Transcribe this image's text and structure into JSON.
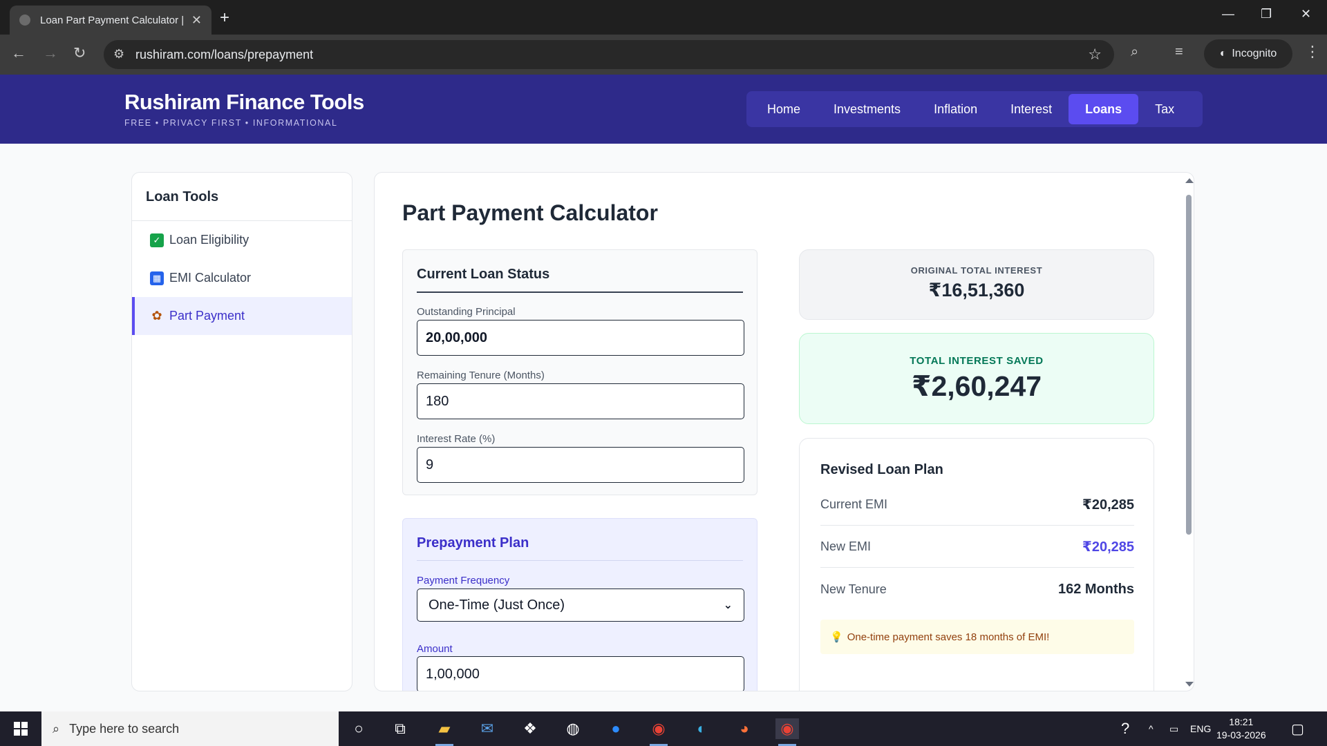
{
  "browser": {
    "tab_title": "Loan Part Payment Calculator | I",
    "url": "rushiram.com/loans/prepayment",
    "incognito_label": "Incognito"
  },
  "site": {
    "brand": "Rushiram Finance Tools",
    "tagline": "FREE • PRIVACY FIRST • INFORMATIONAL",
    "nav": [
      {
        "label": "Home"
      },
      {
        "label": "Investments"
      },
      {
        "label": "Inflation"
      },
      {
        "label": "Interest"
      },
      {
        "label": "Loans",
        "active": true
      },
      {
        "label": "Tax"
      }
    ]
  },
  "sidebar": {
    "title": "Loan Tools",
    "items": [
      {
        "label": "Loan Eligibility",
        "icon": "check-box-icon"
      },
      {
        "label": "EMI Calculator",
        "icon": "calculator-icon"
      },
      {
        "label": "Part Payment",
        "icon": "money-icon",
        "active": true
      }
    ]
  },
  "main": {
    "title": "Part Payment Calculator",
    "current_status": {
      "heading": "Current Loan Status",
      "principal_label": "Outstanding Principal",
      "principal_value": "20,00,000",
      "tenure_label": "Remaining Tenure (Months)",
      "tenure_value": "180",
      "rate_label": "Interest Rate (%)",
      "rate_value": "9"
    },
    "prepayment": {
      "heading": "Prepayment Plan",
      "frequency_label": "Payment Frequency",
      "frequency_value": "One-Time (Just Once)",
      "amount_label": "Amount",
      "amount_value": "1,00,000"
    },
    "results": {
      "original_caption": "ORIGINAL TOTAL INTEREST",
      "original_value": "₹16,51,360",
      "saved_caption": "TOTAL INTEREST SAVED",
      "saved_value": "₹2,60,247",
      "revised_heading": "Revised Loan Plan",
      "rows": [
        {
          "key": "Current EMI",
          "value": "₹20,285"
        },
        {
          "key": "New EMI",
          "value": "₹20,285"
        },
        {
          "key": "New Tenure",
          "value": "162 Months"
        }
      ],
      "tip": "One-time payment saves 18 months of EMI!"
    }
  },
  "taskbar": {
    "search_placeholder": "Type here to search",
    "lang": "ENG",
    "time": "18:21",
    "date": "19-03-2026"
  },
  "colors": {
    "header_bg": "#2e2a8a",
    "accent": "#5b4cf0",
    "saved_bg": "#ecfdf5"
  }
}
